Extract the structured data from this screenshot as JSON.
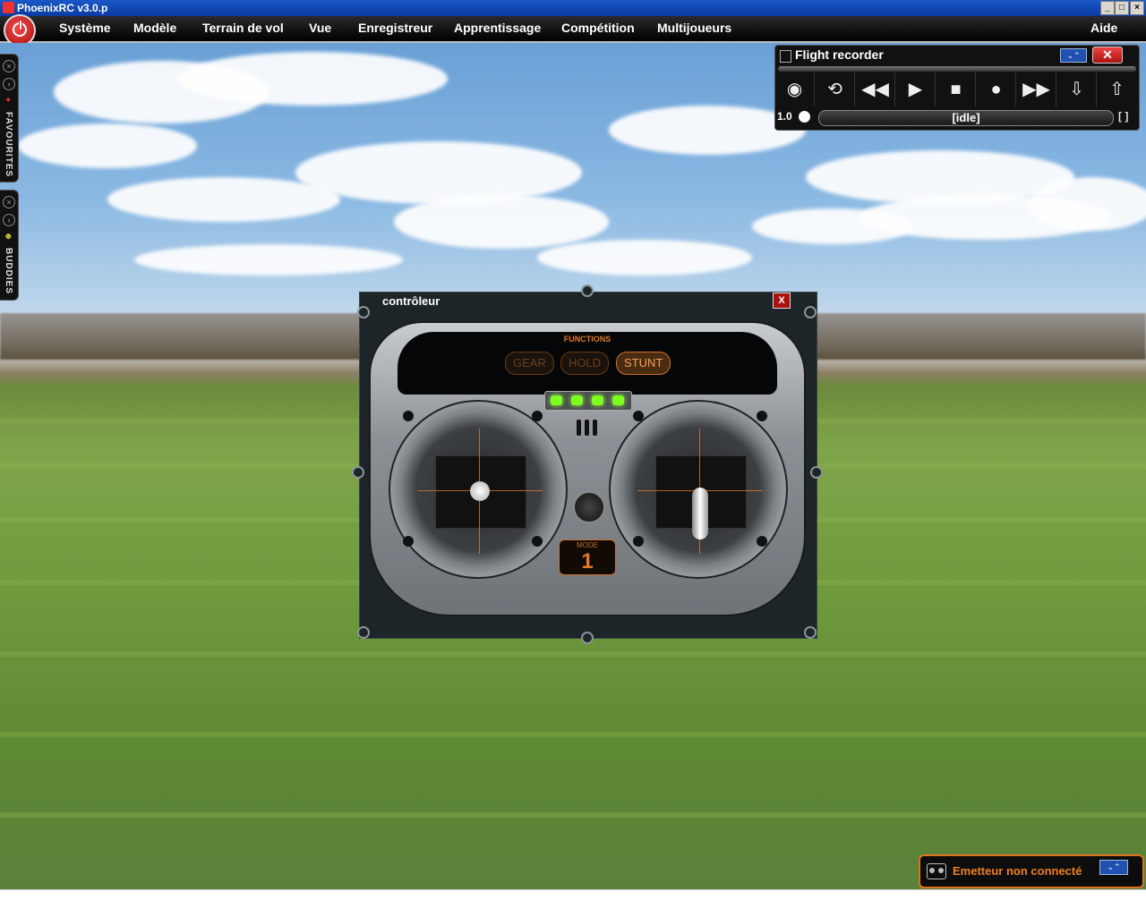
{
  "window": {
    "title": "PhoenixRC v3.0.p"
  },
  "menu": {
    "items": [
      "Système",
      "Modèle",
      "Terrain de vol",
      "Vue",
      "Enregistreur",
      "Apprentissage",
      "Compétition",
      "Multijoueurs"
    ],
    "help": "Aide"
  },
  "side_panels": {
    "favourites": "FAVOURITES",
    "buddies": "BUDDIES"
  },
  "flight_recorder": {
    "title": "Flight recorder",
    "buttons": [
      "view",
      "loop",
      "rewind",
      "play",
      "stop",
      "record",
      "fast-forward",
      "export",
      "import"
    ],
    "speed": "1.0",
    "status": "[idle]",
    "bracket": "[ ]"
  },
  "controller": {
    "title": "contrôleur",
    "close": "X",
    "functions_label": "FUNCTIONS",
    "functions": [
      {
        "label": "GEAR",
        "active": false
      },
      {
        "label": "HOLD",
        "active": false
      },
      {
        "label": "STUNT",
        "active": true
      }
    ],
    "mode_label": "MODE",
    "mode_value": "1"
  },
  "emitter": {
    "status": "Emetteur non connecté"
  },
  "colors": {
    "accent": "#e07828",
    "titlebar": "#0a3aa0",
    "close": "#a11111"
  }
}
